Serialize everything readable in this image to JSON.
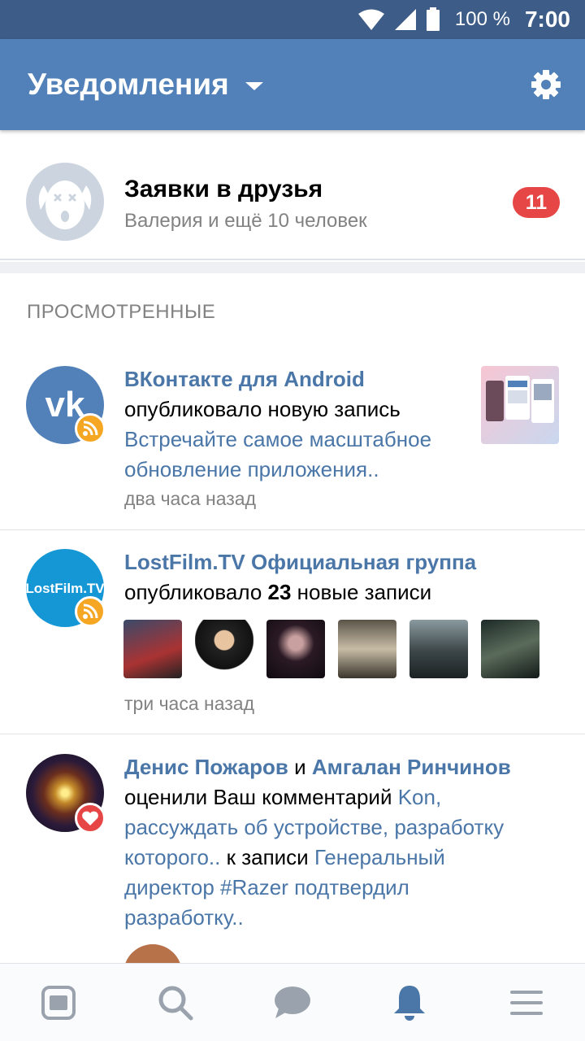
{
  "status_bar": {
    "battery": "100 %",
    "time": "7:00"
  },
  "app_bar": {
    "title": "Уведомления"
  },
  "friend_requests": {
    "title": "Заявки в друзья",
    "subtitle": "Валерия и ещё 10 человек",
    "count": "11"
  },
  "section": {
    "title": "ПРОСМОТРЕННЫЕ"
  },
  "notifications": [
    {
      "name": "ВКонтакте для Android",
      "action": "опубликовало новую запись",
      "post": "Встречайте самое масштабное",
      "post2": "обновление приложения..",
      "time": "два часа назад"
    },
    {
      "name": "LostFilm.TV  Официальная группа",
      "action_pre": "опубликовало ",
      "action_count": "23",
      "action_post": " новые записи",
      "avatar_text": "LostFilm.TV",
      "time": "три часа назад"
    },
    {
      "name1": "Денис Пожаров",
      "and": " и ",
      "name2": "Амгалан Ринчинов",
      "line2_pre": "оценили Ваш комментарий ",
      "line2_link": "Kon,",
      "line3_link": "рассуждать об устройстве, разработку",
      "line4_link": "которого..",
      "line4_mid": " к записи ",
      "line4_link2": "Генеральный",
      "line5_link": "директор #Razer подтвердил",
      "line6_link": "разработку.."
    }
  ],
  "colors": {
    "accent": "#5181b8",
    "link": "#4a76a8",
    "badge": "#e64646",
    "rss": "#f5a623",
    "like": "#e64646"
  }
}
